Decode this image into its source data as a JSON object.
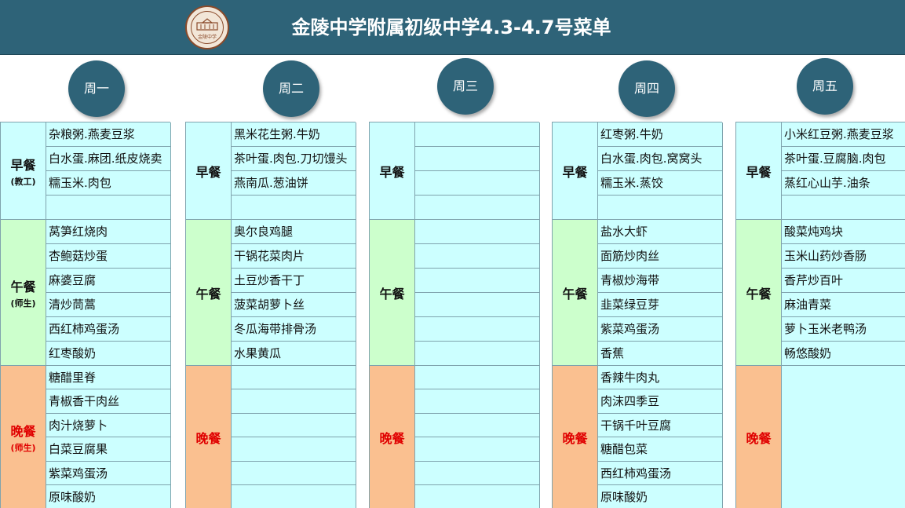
{
  "title": "金陵中学附属初级中学4.3-4.7号菜单",
  "logo": {
    "text": "金陵中学",
    "colors": {
      "fill": "#f2e6d8",
      "stroke": "#8a4a2a"
    }
  },
  "colors": {
    "header": "#2e6378",
    "breakfast": "#ccffff",
    "lunch": "#ccffcc",
    "dinner": "#fac090",
    "dinner_text": "#e00000",
    "item_bg": "#ccffff"
  },
  "meal_labels": {
    "breakfast": "早餐",
    "lunch": "午餐",
    "dinner": "晚餐",
    "breakfast_sub_teacher": "(教工)",
    "sub_teacher_student": "(师生)"
  },
  "days": [
    {
      "name": "周一",
      "breakfast": [
        "杂粮粥.燕麦豆浆",
        "白水蛋.麻团.纸皮烧卖",
        "糯玉米.肉包",
        ""
      ],
      "lunch": [
        "莴笋红烧肉",
        "杏鲍菇炒蛋",
        "麻婆豆腐",
        "清炒茼蒿",
        "西红柿鸡蛋汤",
        "红枣酸奶"
      ],
      "dinner": [
        "糖醋里脊",
        "青椒香干肉丝",
        "肉汁烧萝卜",
        "白菜豆腐果",
        "紫菜鸡蛋汤",
        "原味酸奶"
      ]
    },
    {
      "name": "周二",
      "breakfast": [
        "黑米花生粥.牛奶",
        "茶叶蛋.肉包.刀切馒头",
        "燕南瓜.葱油饼",
        ""
      ],
      "lunch": [
        "奥尔良鸡腿",
        "干锅花菜肉片",
        "土豆炒香干丁",
        "菠菜胡萝卜丝",
        "冬瓜海带排骨汤",
        "水果黄瓜"
      ],
      "dinner": [
        "",
        "",
        "",
        "",
        "",
        ""
      ]
    },
    {
      "name": "周三",
      "breakfast": [
        "",
        "",
        "",
        ""
      ],
      "lunch": [
        "",
        "",
        "",
        "",
        "",
        ""
      ],
      "dinner": [
        "",
        "",
        "",
        "",
        "",
        ""
      ]
    },
    {
      "name": "周四",
      "breakfast": [
        "红枣粥.牛奶",
        "白水蛋.肉包.窝窝头",
        "糯玉米.蒸饺",
        ""
      ],
      "lunch": [
        "盐水大虾",
        "面筋炒肉丝",
        "青椒炒海带",
        "韭菜绿豆芽",
        "紫菜鸡蛋汤",
        "香蕉"
      ],
      "dinner": [
        "香辣牛肉丸",
        "肉沫四季豆",
        "干锅千叶豆腐",
        "糖醋包菜",
        "西红柿鸡蛋汤",
        "原味酸奶"
      ]
    },
    {
      "name": "周五",
      "breakfast": [
        "小米红豆粥.燕麦豆浆",
        "茶叶蛋.豆腐脑.肉包",
        "蒸红心山芋.油条",
        ""
      ],
      "lunch": [
        "酸菜炖鸡块",
        "玉米山药炒香肠",
        "香芹炒百叶",
        "麻油青菜",
        "萝卜玉米老鸭汤",
        "畅悠酸奶"
      ],
      "dinner": []
    }
  ]
}
